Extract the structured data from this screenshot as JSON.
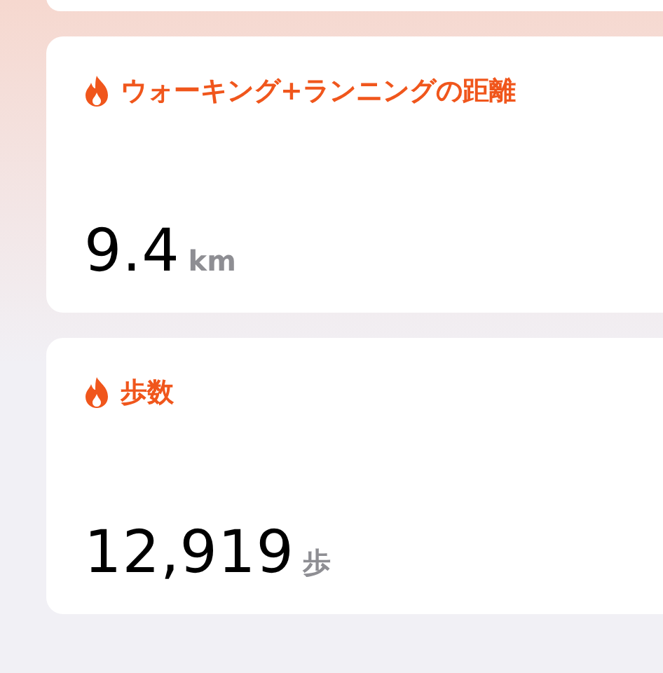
{
  "cards": [
    {
      "title": "ウォーキング+ランニングの距離",
      "value": "9.4",
      "unit": "km"
    },
    {
      "title": "歩数",
      "value": "12,919",
      "unit": "歩"
    }
  ]
}
